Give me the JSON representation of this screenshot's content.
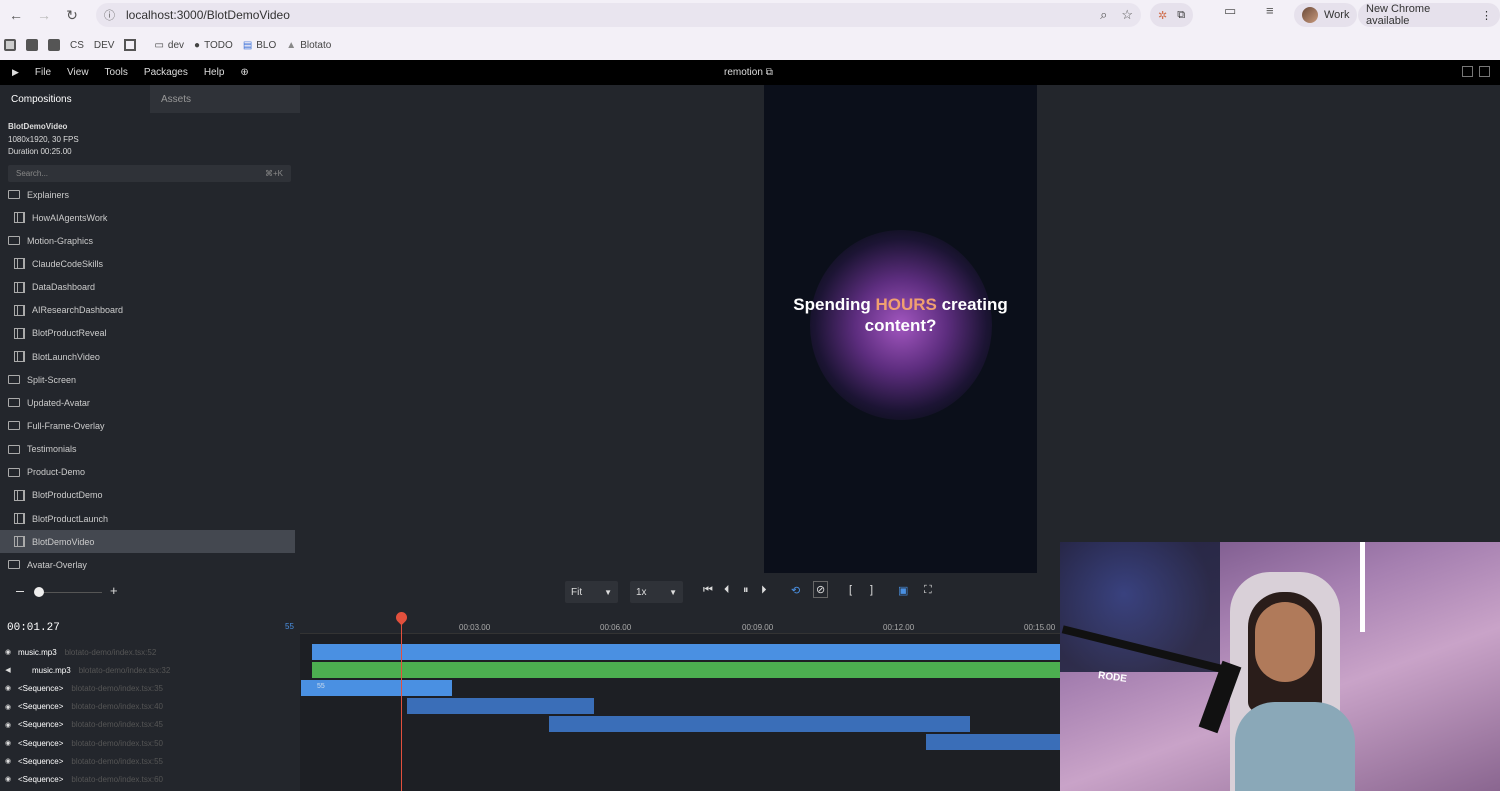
{
  "browser": {
    "url": "localhost:3000/BlotDemoVideo",
    "profile_label": "Work",
    "update_label": "New Chrome available",
    "bookmarks": [
      "CS",
      "DEV",
      "dev",
      "TODO",
      "BLO",
      "Blotato"
    ]
  },
  "menu": {
    "items": [
      "File",
      "View",
      "Tools",
      "Packages",
      "Help"
    ],
    "center_title": "remotion"
  },
  "sidebar": {
    "tabs": [
      "Compositions",
      "Assets"
    ],
    "composition": {
      "name": "BlotDemoVideo",
      "specs": "1080x1920, 30 FPS",
      "duration": "Duration 00:25.00"
    },
    "search": {
      "placeholder": "Search...",
      "shortcut": "⌘+K"
    },
    "tree": [
      {
        "label": "Explainers",
        "type": "folder"
      },
      {
        "label": "HowAIAgentsWork",
        "type": "comp"
      },
      {
        "label": "Motion-Graphics",
        "type": "folder"
      },
      {
        "label": "ClaudeCodeSkills",
        "type": "comp"
      },
      {
        "label": "DataDashboard",
        "type": "comp"
      },
      {
        "label": "AIResearchDashboard",
        "type": "comp"
      },
      {
        "label": "BlotProductReveal",
        "type": "comp"
      },
      {
        "label": "BlotLaunchVideo",
        "type": "comp"
      },
      {
        "label": "Split-Screen",
        "type": "folder"
      },
      {
        "label": "Updated-Avatar",
        "type": "folder"
      },
      {
        "label": "Full-Frame-Overlay",
        "type": "folder"
      },
      {
        "label": "Testimonials",
        "type": "folder"
      },
      {
        "label": "Product-Demo",
        "type": "folder"
      },
      {
        "label": "BlotProductDemo",
        "type": "comp"
      },
      {
        "label": "BlotProductLaunch",
        "type": "comp"
      },
      {
        "label": "BlotDemoVideo",
        "type": "comp",
        "selected": true
      },
      {
        "label": "Avatar-Overlay",
        "type": "folder"
      }
    ]
  },
  "preview": {
    "headline_before": "Spending ",
    "headline_highlight": "HOURS",
    "headline_after": " creating",
    "headline_line2": "content?"
  },
  "controls": {
    "fit_label": "Fit",
    "speed_label": "1x"
  },
  "timeline": {
    "timecode": "00:01.27",
    "timecode_badge": "55",
    "ticks": [
      "00:03.00",
      "00:06.00",
      "00:09.00",
      "00:12.00",
      "00:15.00"
    ],
    "tracks": [
      {
        "name": "music.mp3",
        "source": "blotato-demo/index.tsx:52"
      },
      {
        "name": "music.mp3",
        "source": "blotato-demo/index.tsx:32"
      },
      {
        "name": "<Sequence>",
        "source": "blotato-demo/index.tsx:35"
      },
      {
        "name": "<Sequence>",
        "source": "blotato-demo/index.tsx:40"
      },
      {
        "name": "<Sequence>",
        "source": "blotato-demo/index.tsx:45"
      },
      {
        "name": "<Sequence>",
        "source": "blotato-demo/index.tsx:50"
      },
      {
        "name": "<Sequence>",
        "source": "blotato-demo/index.tsx:55"
      },
      {
        "name": "<Sequence>",
        "source": "blotato-demo/index.tsx:60"
      }
    ],
    "seq_clip_label": "55"
  },
  "webcam": {
    "mic_brand": "RODE"
  },
  "colors": {
    "accent_blue": "#4a90e2",
    "track_green": "#4caf50",
    "playhead_red": "#e2503d",
    "highlight_orange": "#f0a070"
  }
}
